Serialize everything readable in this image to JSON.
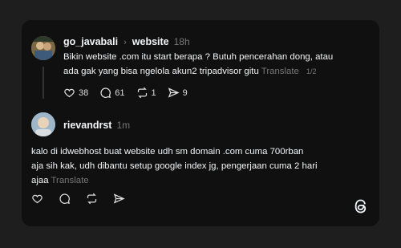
{
  "post1": {
    "username": "go_javabali",
    "topic": "website",
    "time": "18h",
    "line1": "Bikin website .com itu start berapa ? Butuh pencerahan dong, atau",
    "line2": "ada gak yang bisa ngelola akun2 tripadvisor gitu",
    "translate": "Translate",
    "pager": "1/2",
    "likes": "38",
    "replies": "61",
    "reposts": "1",
    "shares": "9"
  },
  "post2": {
    "username": "rievandrst",
    "time": "1m",
    "line1": "kalo di idwebhost buat website udh sm domain .com cuma 700rban",
    "line2": "aja sih kak, udh dibantu setup google index jg, pengerjaan cuma 2 hari",
    "line3": "ajaa",
    "translate": "Translate"
  },
  "icons": [
    "chevron-right-icon",
    "heart-icon",
    "comment-icon",
    "repost-icon",
    "share-icon",
    "threads-logo-icon"
  ]
}
